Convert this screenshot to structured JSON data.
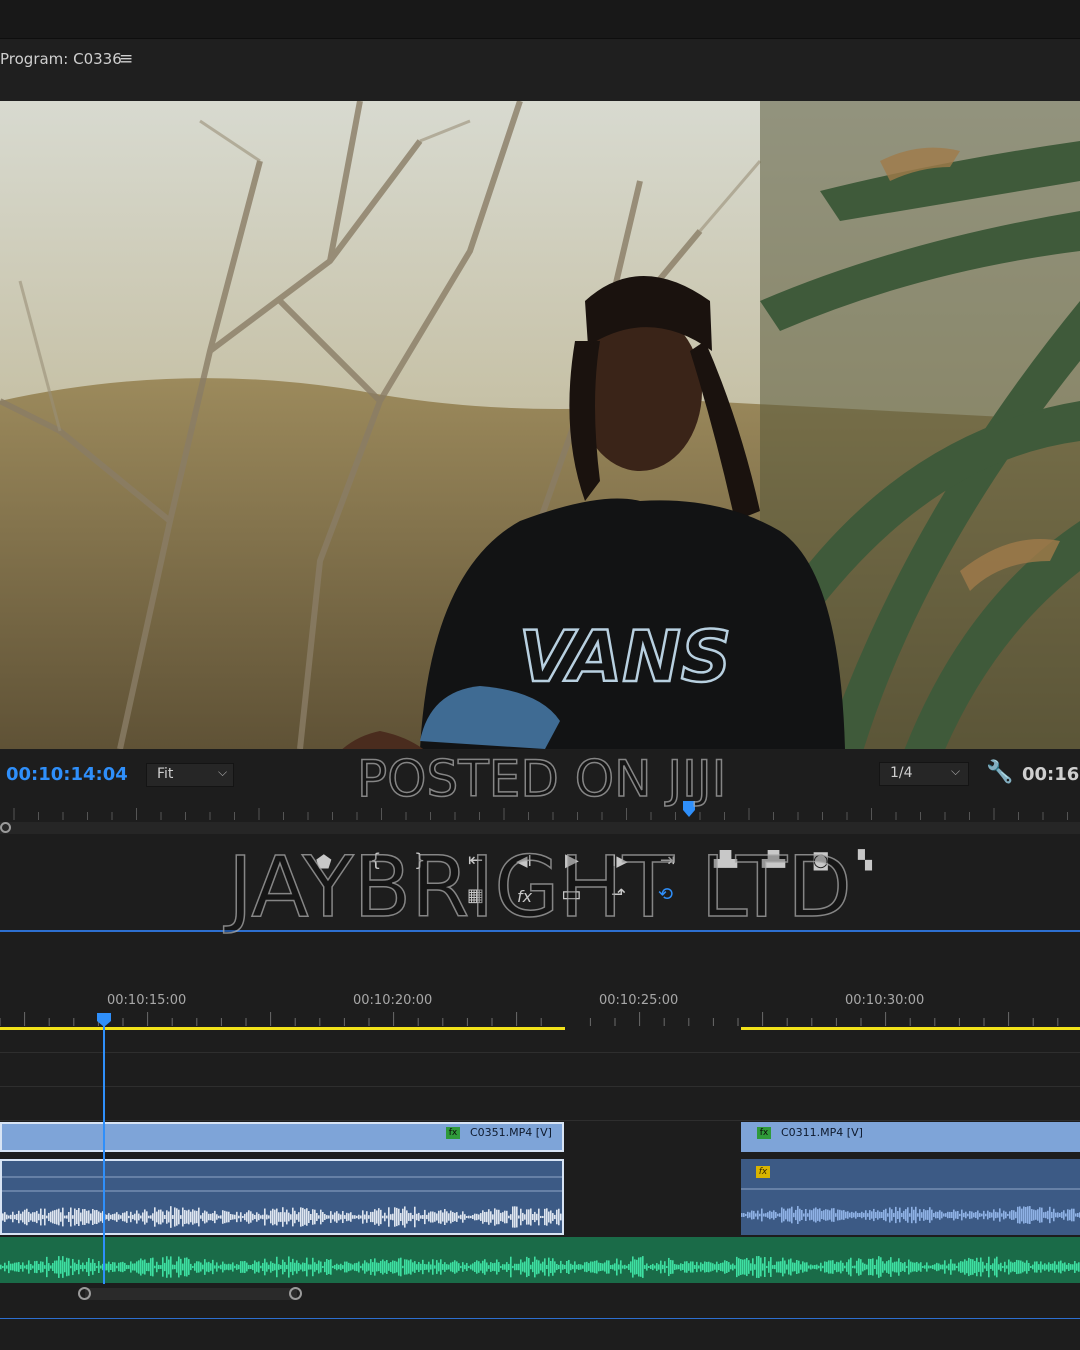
{
  "program_monitor": {
    "title": "Program: C0336",
    "menu_icon": "hamburger-menu-icon",
    "timecode_current": "00:10:14:04",
    "zoom_value": "Fit",
    "resolution_value": "1/4",
    "timecode_duration": "00:16:",
    "settings_icon": "wrench-icon"
  },
  "transport_controls": [
    {
      "name": "add-marker-icon",
      "glyph": "⬟"
    },
    {
      "name": "mark-in-icon",
      "glyph": "{"
    },
    {
      "name": "mark-out-icon",
      "glyph": "}"
    },
    {
      "name": "go-to-in-icon",
      "glyph": "⇤"
    },
    {
      "name": "step-back-icon",
      "glyph": "◀I"
    },
    {
      "name": "play-icon",
      "glyph": "▶"
    },
    {
      "name": "step-forward-icon",
      "glyph": "I▶"
    },
    {
      "name": "go-to-out-icon",
      "glyph": "⇥"
    },
    {
      "name": "lift-icon",
      "glyph": "▟▙"
    },
    {
      "name": "extract-icon",
      "glyph": "▟▙"
    },
    {
      "name": "export-frame-icon",
      "glyph": "◙"
    },
    {
      "name": "comparison-view-icon",
      "glyph": "▚"
    },
    {
      "name": "trim-icon",
      "glyph": "▦"
    },
    {
      "name": "fx-icon",
      "glyph": "fx"
    },
    {
      "name": "safe-margins-icon",
      "glyph": "▭"
    },
    {
      "name": "insert-icon",
      "glyph": "⬏"
    },
    {
      "name": "loop-icon",
      "glyph": "⟲"
    }
  ],
  "timeline": {
    "ruler_labels": [
      "00:10:15:00",
      "00:10:20:00",
      "00:10:25:00",
      "00:10:30:00"
    ],
    "clips": [
      {
        "label": "C0351.MP4 [V]"
      },
      {
        "label": "C0311.MP4 [V]"
      }
    ],
    "fx_label": "fx",
    "colors": {
      "playhead": "#2f8ffa",
      "work_area": "#f2e21a",
      "video_clip": "#7ea4d8",
      "audio_clip": "#3c5a85",
      "music_track": "#1a6b48",
      "music_wave": "#3ee0a2"
    }
  },
  "watermarks": {
    "line1": "POSTED ON JIJI",
    "line2": "JAYBRIGHT LTD"
  }
}
